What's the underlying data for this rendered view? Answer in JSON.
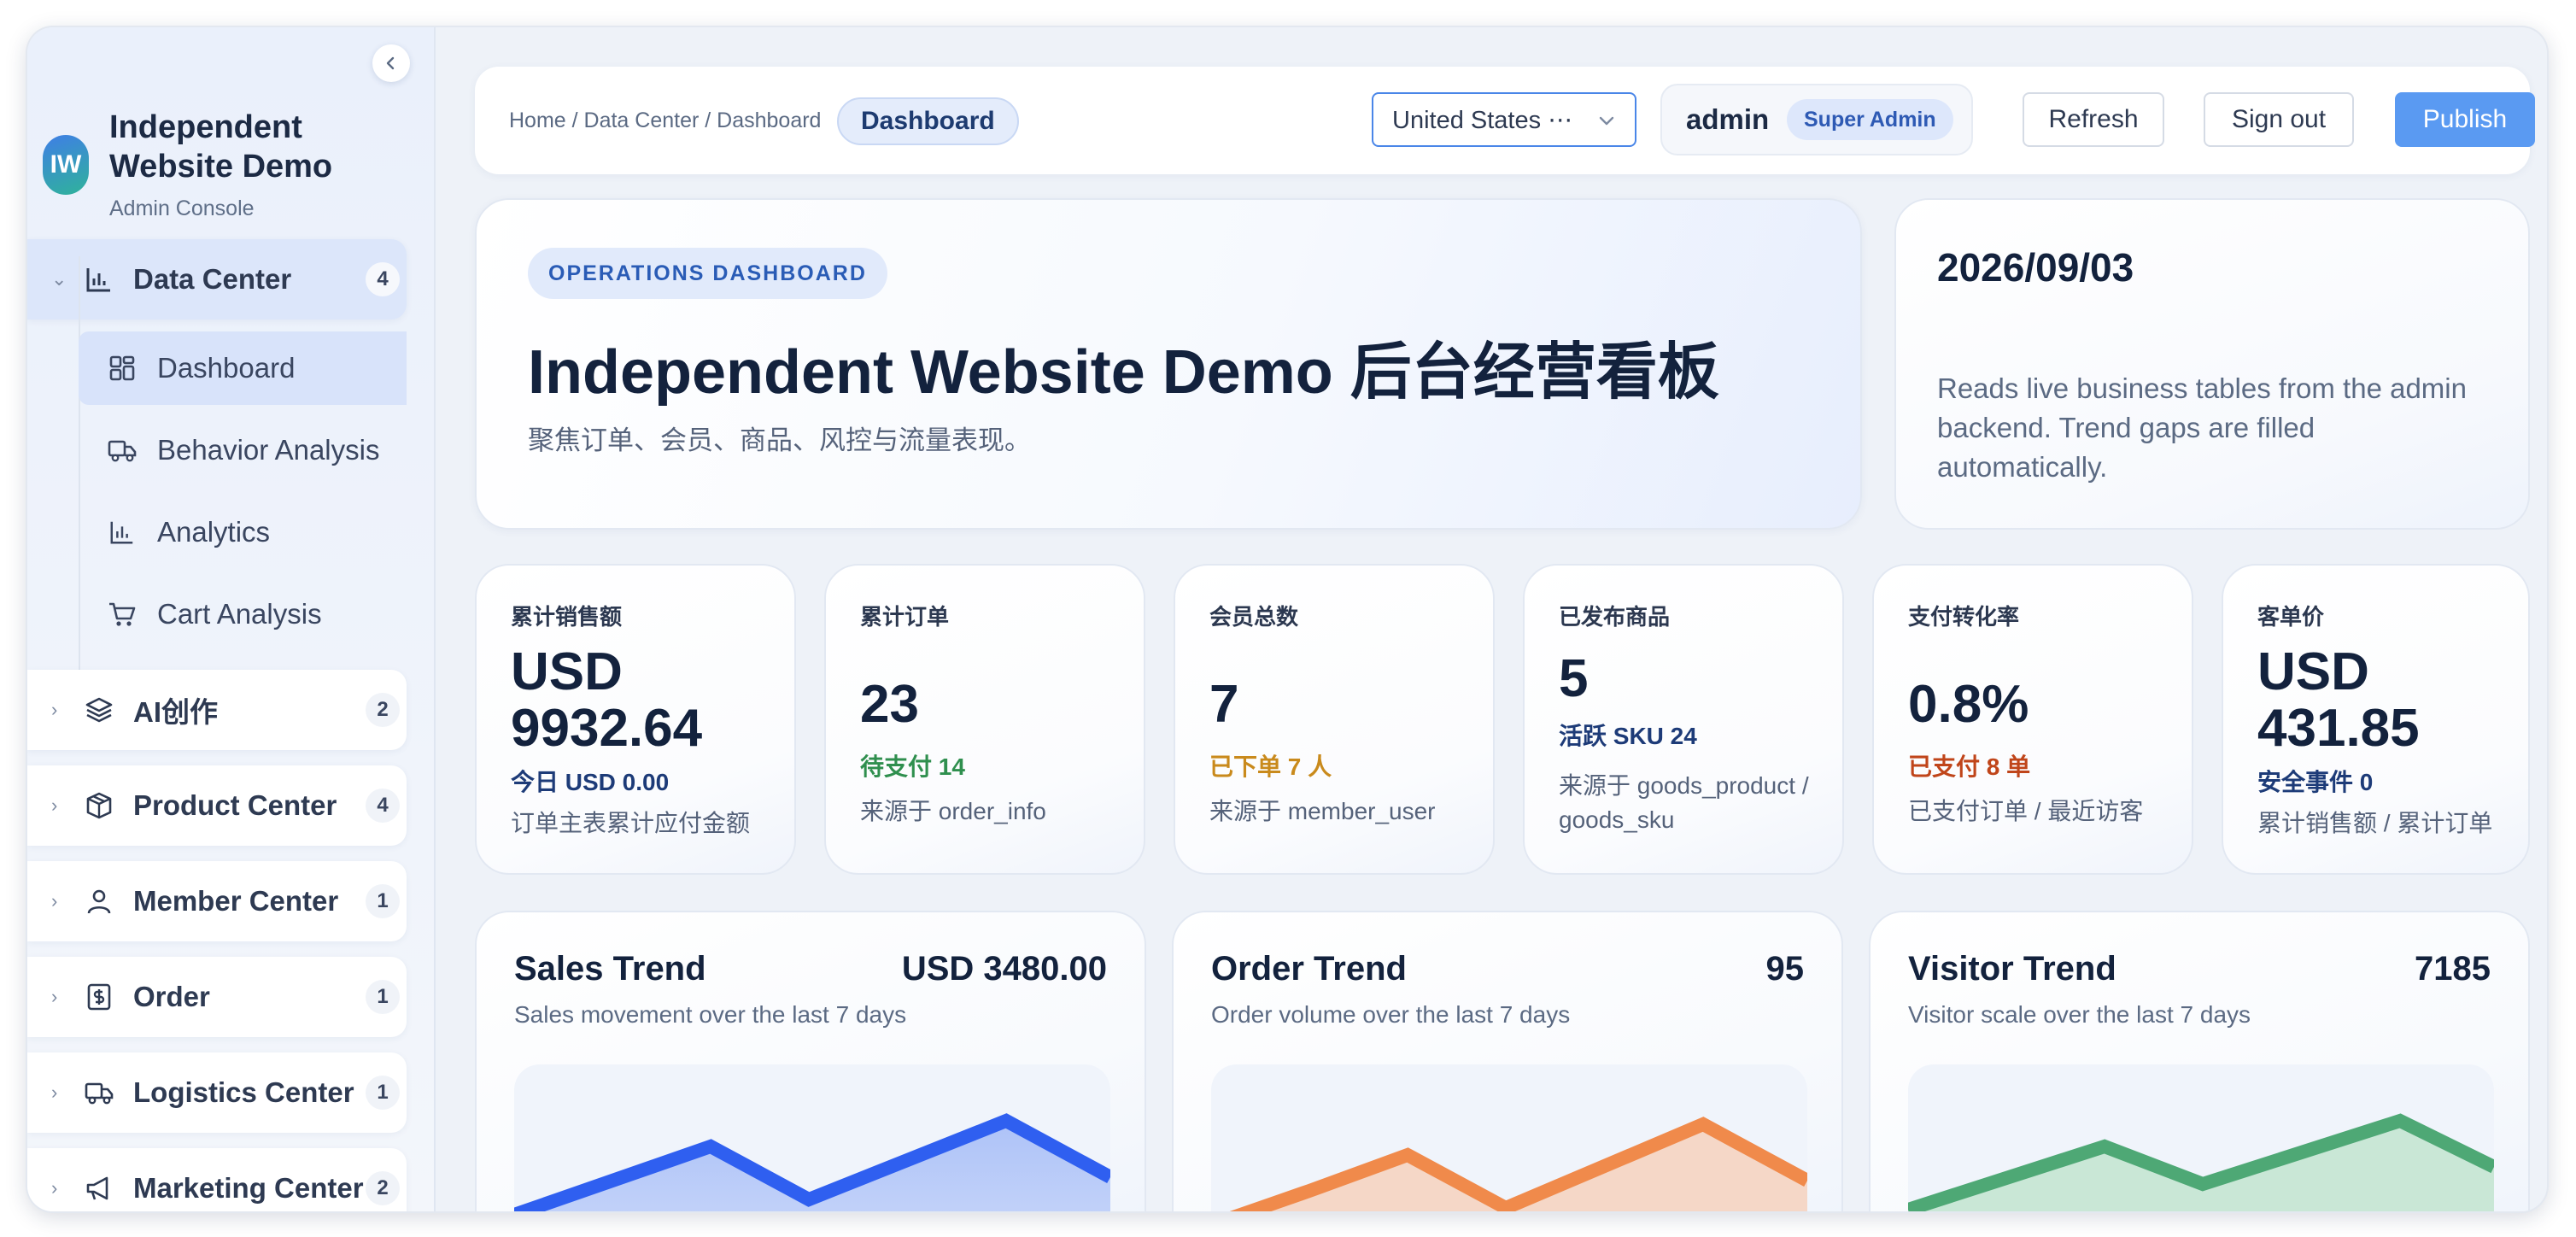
{
  "sidebar": {
    "brand": {
      "logo": "IW",
      "name": "Independent Website Demo",
      "subtitle": "Admin Console"
    },
    "groups": [
      {
        "label": "Data Center",
        "count": "4",
        "icon": "chart-icon",
        "expanded": true,
        "items": [
          {
            "label": "Dashboard",
            "icon": "dashboard-icon",
            "active": true
          },
          {
            "label": "Behavior Analysis",
            "icon": "truck-icon"
          },
          {
            "label": "Analytics",
            "icon": "chart-icon"
          },
          {
            "label": "Cart Analysis",
            "icon": "cart-icon"
          }
        ]
      },
      {
        "label": "AI创作",
        "count": "2",
        "icon": "layers-icon"
      },
      {
        "label": "Product Center",
        "count": "4",
        "icon": "box-icon"
      },
      {
        "label": "Member Center",
        "count": "1",
        "icon": "user-icon"
      },
      {
        "label": "Order",
        "count": "1",
        "icon": "order-icon"
      },
      {
        "label": "Logistics Center",
        "count": "1",
        "icon": "truck-icon"
      },
      {
        "label": "Marketing Center",
        "count": "2",
        "icon": "megaphone-icon"
      }
    ]
  },
  "header": {
    "breadcrumb": "Home / Data Center / Dashboard",
    "current": "Dashboard",
    "region": "United States ⋯",
    "user": {
      "name": "admin",
      "role": "Super Admin"
    },
    "buttons": {
      "refresh": "Refresh",
      "signout": "Sign out",
      "publish": "Publish"
    }
  },
  "hero": {
    "tag": "OPERATIONS DASHBOARD",
    "title": "Independent Website Demo 后台经营看板",
    "subtitle": "聚焦订单、会员、商品、风控与流量表现。"
  },
  "date_card": {
    "date": "2026/09/03",
    "note": "Reads live business tables from the admin backend. Trend gaps are filled automatically."
  },
  "kpis": [
    {
      "label": "累计销售额",
      "value": "USD 9932.64",
      "highlight": "今日 USD 0.00",
      "footnote": "订单主表累计应付金额"
    },
    {
      "label": "累计订单",
      "value": "23",
      "highlight": "待支付 14",
      "footnote": "来源于 order_info"
    },
    {
      "label": "会员总数",
      "value": "7",
      "highlight": "已下单 7 人",
      "footnote": "来源于 member_user"
    },
    {
      "label": "已发布商品",
      "value": "5",
      "highlight": "活跃 SKU 24",
      "footnote": "来源于 goods_product / goods_sku"
    },
    {
      "label": "支付转化率",
      "value": "0.8%",
      "highlight": "已支付 8 单",
      "footnote": "已支付订单 / 最近访客"
    },
    {
      "label": "客单价",
      "value": "USD 431.85",
      "highlight": "安全事件 0",
      "footnote": "累计销售额 / 累计订单"
    }
  ],
  "colors": {
    "accent": "#5a9af2",
    "sales": "#2f5ff0",
    "orders": "#f08a4b",
    "visitors": "#4ea875",
    "positive": "#2f8f4e",
    "warning": "#c98a1c",
    "danger": "#c0451a",
    "info": "#1d3b78"
  },
  "trends": [
    {
      "title": "Sales Trend",
      "total": "USD 3480.00",
      "subtitle": "Sales movement over the last 7 days"
    },
    {
      "title": "Order Trend",
      "total": "95",
      "subtitle": "Order volume over the last 7 days"
    },
    {
      "title": "Visitor Trend",
      "total": "7185",
      "subtitle": "Visitor scale over the last 7 days"
    }
  ]
}
